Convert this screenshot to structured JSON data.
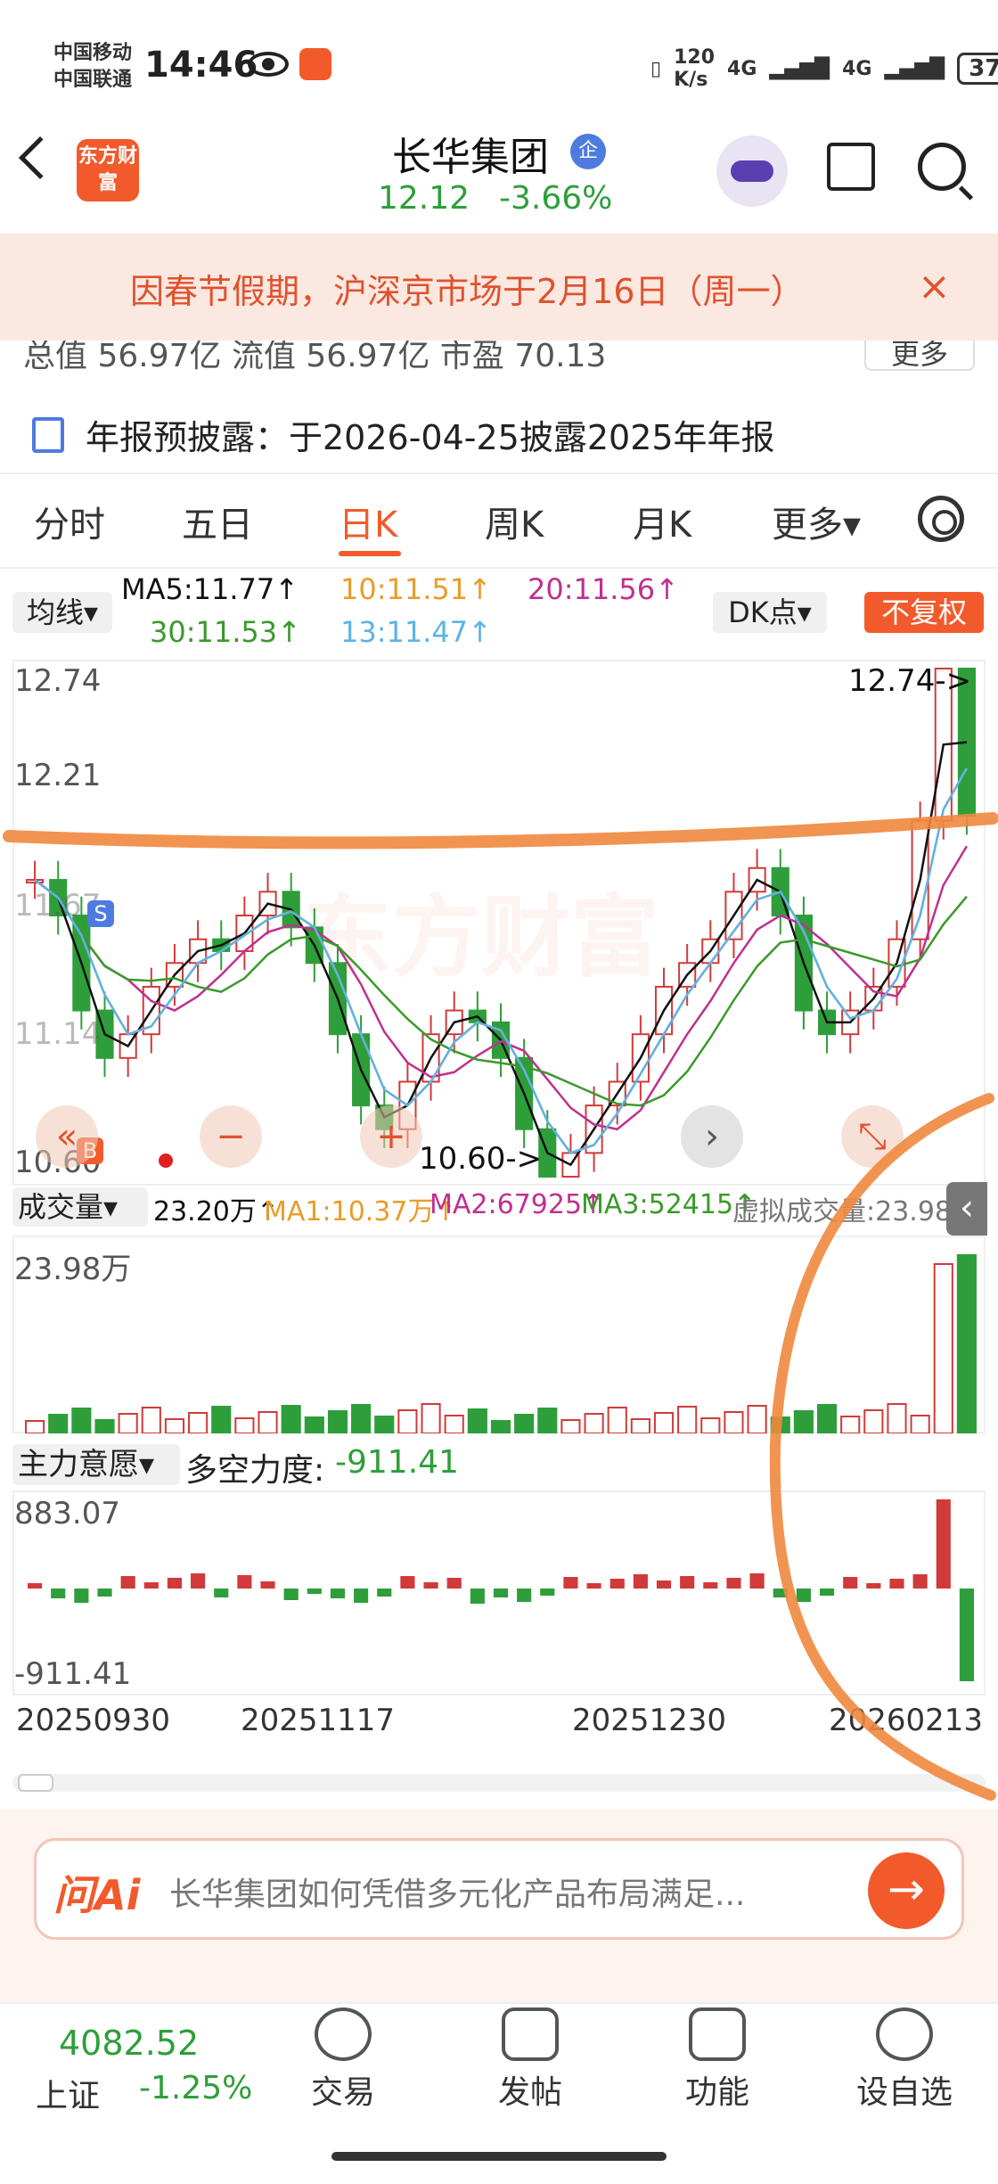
{
  "status_bar": {
    "carrier1": "中国移动",
    "carrier2": "中国联通",
    "time": "14:46",
    "net_speed": "120 K/s",
    "signal1": "4G",
    "signal2": "4G",
    "battery": "37"
  },
  "header": {
    "logo_text": "东方财富",
    "stock_name": "长华集团",
    "badge": "企",
    "price": "12.12",
    "change_pct": "-3.66%"
  },
  "notice": {
    "text": "因春节假期，沪深京市场于2月16日（周一）",
    "close": "×"
  },
  "metrics_cut": {
    "text": "总值 56.97亿   流值 56.97亿   市盈   70.13",
    "more": "更多"
  },
  "annual_report": "年报预披露：于2026-04-25披露2025年年报",
  "tabs": [
    "分时",
    "五日",
    "日K",
    "周K",
    "月K",
    "更多▾"
  ],
  "active_tab": "日K",
  "ma": {
    "selector": "均线▾",
    "ma5": "MA5:11.77↑",
    "ma10": "10:11.51↑",
    "ma20": "20:11.56↑",
    "ma30": "30:11.53↑",
    "ma13": "13:11.47↑",
    "dk": "DK点▾",
    "fq": "不复权"
  },
  "colors": {
    "accent": "#f25a2b",
    "up": "#d13a3a",
    "down": "#2e9e3a",
    "ma5": "#111111",
    "ma10": "#e89c2a",
    "ma20": "#c0308e",
    "ma30": "#3a9a2a",
    "ma13": "#5db3e8"
  },
  "kline": {
    "y_high": "12.74",
    "y_mid1": "12.21",
    "y_mid2": "11.67",
    "y_mid3": "11.14",
    "y_low": "10.60",
    "hi_tag": "12.74->",
    "lo_tag": "10.60->",
    "watermark": "东方财富",
    "buy_marker": "B",
    "sell_marker": "S"
  },
  "chart_data": {
    "type": "candlestick",
    "ylim": [
      10.6,
      12.74
    ],
    "ohlc_close_trend": [
      11.85,
      11.7,
      11.3,
      11.1,
      11.2,
      11.4,
      11.5,
      11.6,
      11.55,
      11.7,
      11.8,
      11.65,
      11.5,
      11.2,
      10.9,
      10.8,
      11.0,
      11.2,
      11.3,
      11.25,
      11.1,
      10.8,
      10.6,
      10.7,
      10.9,
      11.0,
      11.2,
      11.4,
      11.5,
      11.6,
      11.8,
      11.9,
      11.7,
      11.3,
      11.2,
      11.3,
      11.4,
      11.6,
      12.1,
      12.74,
      12.12
    ],
    "volume_max": "23.98万",
    "mainforce_range": [
      "883.07",
      "-911.41"
    ]
  },
  "volume": {
    "selector": "成交量▾",
    "vol": "23.20万↑",
    "ma1": "MA1:10.37万↑",
    "ma2": "MA2:67925↑",
    "ma3": "MA3:52415↑",
    "virtual": "虚拟成交量:23.98万",
    "max_label": "23.98万"
  },
  "mainforce": {
    "selector": "主力意愿▾",
    "value_label": "多空力度:",
    "value": "-911.41",
    "top": "883.07",
    "bottom": "-911.41"
  },
  "dates": [
    "20250930",
    "20251117",
    "20251230",
    "20260213"
  ],
  "ai": {
    "logo": "问Ai",
    "prompt": "长华集团如何凭借多元化产品布局满足...",
    "go": "→"
  },
  "bottom": {
    "index_value": "4082.52",
    "index_name": "上证",
    "index_pct": "-1.25%",
    "nav": [
      "交易",
      "发帖",
      "功能",
      "设自选"
    ]
  }
}
